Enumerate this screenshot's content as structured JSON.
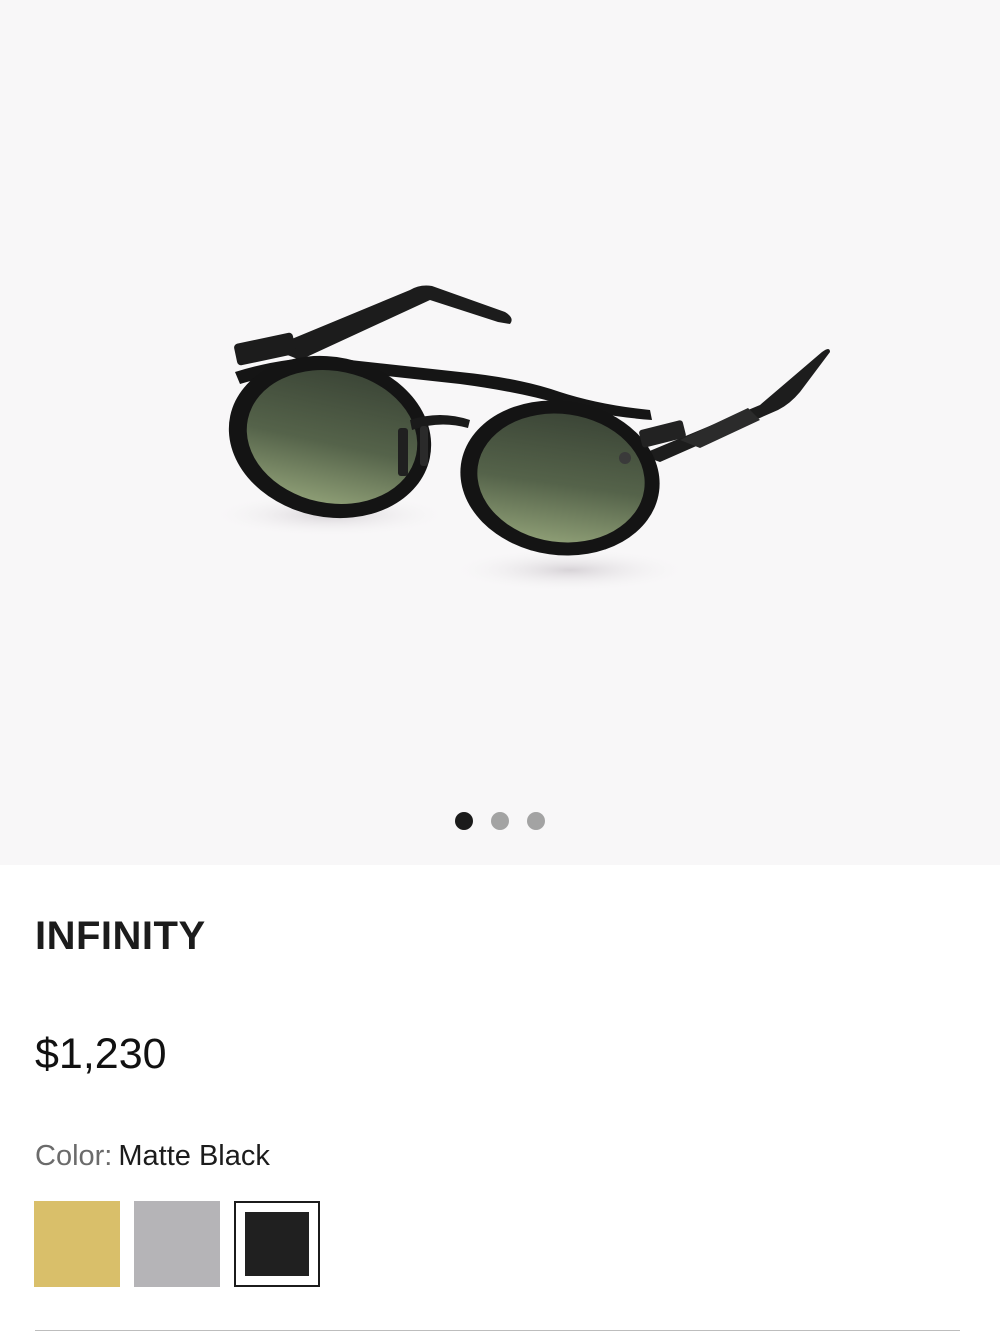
{
  "gallery": {
    "image_subject": "sunglasses-product-photo",
    "dots_count": 3,
    "active_dot": 0
  },
  "product": {
    "name": "INFINITY",
    "price": "$1,230",
    "color_label": "Color:",
    "color_value": "Matte Black"
  },
  "swatches": [
    {
      "color": "#d9bf6a",
      "selected": false
    },
    {
      "color": "#b5b4b7",
      "selected": false
    },
    {
      "color": "#202020",
      "selected": true
    }
  ],
  "colors": {
    "background": "#ffffff",
    "gallery_bg": "#f8f7f8",
    "dot_active": "#1b1b1b",
    "dot_inactive": "#a3a3a3",
    "lens_top": "#5c6a52",
    "lens_bottom": "#8fa07a"
  }
}
